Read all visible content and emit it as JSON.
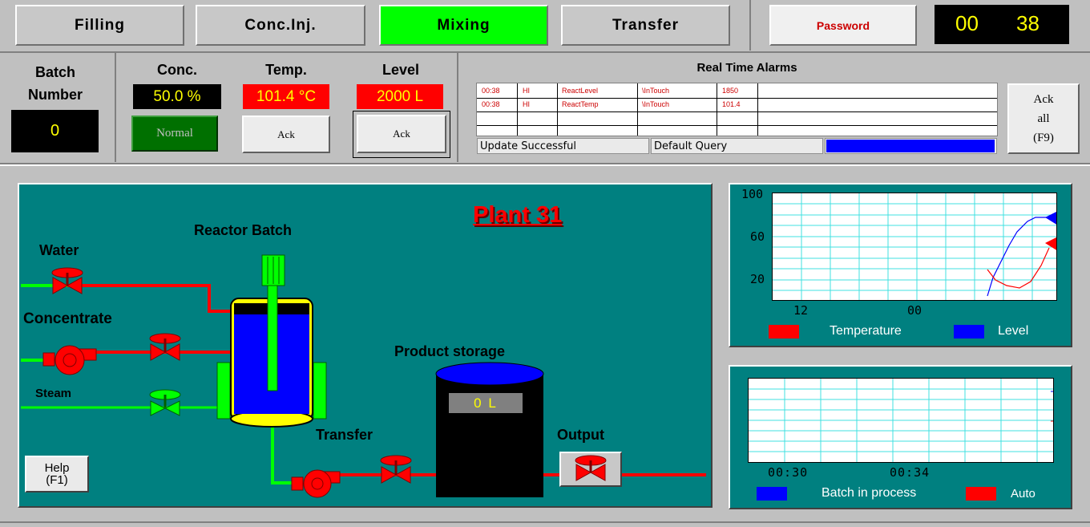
{
  "tabs": [
    {
      "label": "Filling",
      "active": false
    },
    {
      "label": "Conc.Inj.",
      "active": false
    },
    {
      "label": "Mixing",
      "active": true
    },
    {
      "label": "Transfer",
      "active": false
    }
  ],
  "password_label": "Password",
  "clock": {
    "hours": "00",
    "minutes": "38"
  },
  "batch": {
    "title_line1": "Batch",
    "title_line2": "Number",
    "value": "0"
  },
  "conc": {
    "label": "Conc.",
    "value": "50.0 %",
    "status": "Normal"
  },
  "temp": {
    "label": "Temp.",
    "value": "101.4 °C",
    "ack": "Ack"
  },
  "level": {
    "label": "Level",
    "value": "2000 L",
    "ack": "Ack"
  },
  "alarms": {
    "title": "Real Time Alarms",
    "rows": [
      {
        "time": "00:38",
        "type": "HI",
        "tag": "ReactLevel",
        "source": "\\InTouch",
        "value": "1850"
      },
      {
        "time": "00:38",
        "type": "HI",
        "tag": "ReactTemp",
        "source": "\\InTouch",
        "value": "101.4"
      }
    ],
    "status_update": "Update Successful",
    "status_query": "Default Query",
    "ack_all_line1": "Ack",
    "ack_all_line2": "all",
    "ack_all_line3": "(F9)"
  },
  "plant": {
    "title": "Plant 31",
    "reactor_label": "Reactor Batch",
    "water_label": "Water",
    "concentrate_label": "Concentrate",
    "steam_label": "Steam",
    "product_storage_label": "Product storage",
    "storage_level": "0 L",
    "transfer_label": "Transfer",
    "output_label": "Output",
    "help_line1": "Help",
    "help_line2": "(F1)"
  },
  "trend1": {
    "y_ticks": [
      "100",
      "60",
      "20"
    ],
    "x_ticks": [
      "12",
      "00"
    ],
    "legend": [
      {
        "name": "Temperature",
        "color": "#ff0000"
      },
      {
        "name": "Level",
        "color": "#0000ff"
      }
    ]
  },
  "trend2": {
    "x_ticks": [
      "00:30",
      "00:34"
    ],
    "legend": [
      {
        "name": "Batch in process",
        "color": "#0000ff"
      },
      {
        "name": "Auto",
        "color": "#ff0000"
      }
    ]
  },
  "colors": {
    "active_tab": "#00ff00",
    "panel": "#008080",
    "alarm_text": "#cc0000"
  }
}
